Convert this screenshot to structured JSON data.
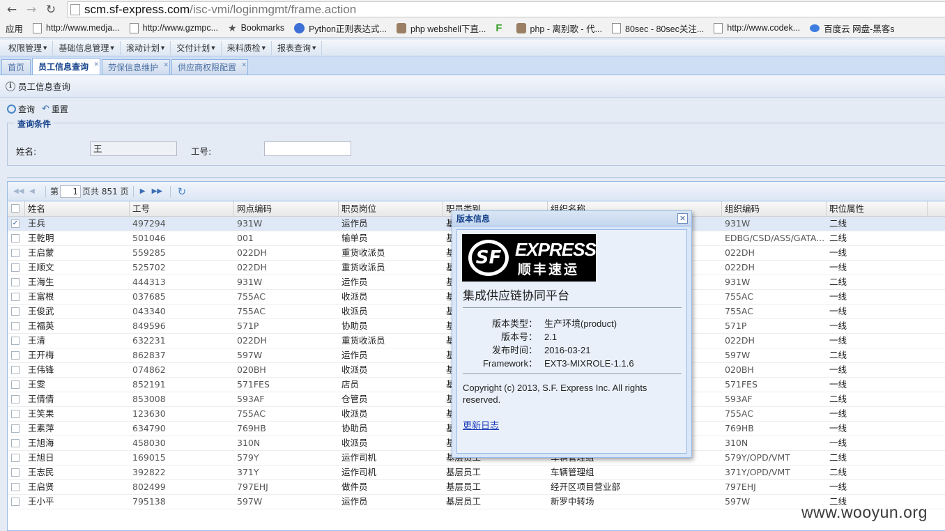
{
  "browser": {
    "url_host": "scm.sf-express.com",
    "url_path": "/isc-vmi/loginmgmt/frame.action",
    "bookmarks": [
      {
        "label": "应用",
        "icon": "apps-grid-icon"
      },
      {
        "label": "http://www.medja...",
        "icon": "page-icon"
      },
      {
        "label": "http://www.gzmpc...",
        "icon": "page-icon"
      },
      {
        "label": "Bookmarks",
        "icon": "star-icon"
      },
      {
        "label": "Python正则表达式...",
        "icon": "python-icon"
      },
      {
        "label": "php webshell下直...",
        "icon": "dog-icon"
      },
      {
        "label": "",
        "icon": "feedly-icon"
      },
      {
        "label": "php - 离别歌 - 代...",
        "icon": "dog-icon"
      },
      {
        "label": "80sec - 80sec关注...",
        "icon": "page-icon"
      },
      {
        "label": "http://www.codek...",
        "icon": "page-icon"
      },
      {
        "label": "百度云 网盘-黑客s",
        "icon": "cloud-icon"
      }
    ]
  },
  "menu": [
    "权限管理",
    "基础信息管理",
    "滚动计划",
    "交付计划",
    "来料质检",
    "报表查询"
  ],
  "tabs": [
    {
      "label": "首页",
      "active": false,
      "closable": false
    },
    {
      "label": "员工信息查询",
      "active": true,
      "closable": true
    },
    {
      "label": "劳保信息维护",
      "active": false,
      "closable": true
    },
    {
      "label": "供应商权限配置",
      "active": false,
      "closable": true
    }
  ],
  "panel": {
    "title": "员工信息查询",
    "query_label": "查询",
    "reset_label": "重置",
    "criteria_legend": "查询条件",
    "name_label": "姓名:",
    "name_value": "王",
    "id_label": "工号:",
    "id_value": ""
  },
  "pager": {
    "prefix": "第",
    "page": "1",
    "suffix": "页共 851 页"
  },
  "grid": {
    "columns": [
      "姓名",
      "工号",
      "网点编码",
      "职员岗位",
      "职员类别",
      "组织名称",
      "组织编码",
      "职位属性"
    ],
    "rows": [
      [
        "王兵",
        "497294",
        "931W",
        "运作员",
        "基",
        "",
        "931W",
        "二线"
      ],
      [
        "王乾明",
        "501046",
        "001",
        "输单员",
        "基",
        "",
        "EDBG/CSD/ASS/GATA...",
        "二线"
      ],
      [
        "王启蒙",
        "559285",
        "022DH",
        "重货收派员",
        "基",
        "",
        "022DH",
        "一线"
      ],
      [
        "王顺文",
        "525702",
        "022DH",
        "重货收派员",
        "基",
        "",
        "022DH",
        "一线"
      ],
      [
        "王海生",
        "444313",
        "931W",
        "运作员",
        "基",
        "",
        "931W",
        "二线"
      ],
      [
        "王富根",
        "037685",
        "755AC",
        "收派员",
        "基",
        "",
        "755AC",
        "一线"
      ],
      [
        "王俊武",
        "043340",
        "755AC",
        "收派员",
        "基",
        "",
        "755AC",
        "一线"
      ],
      [
        "王福英",
        "849596",
        "571P",
        "协助员",
        "基",
        "",
        "571P",
        "一线"
      ],
      [
        "王清",
        "632231",
        "022DH",
        "重货收派员",
        "基",
        "",
        "022DH",
        "一线"
      ],
      [
        "王开梅",
        "862837",
        "597W",
        "运作员",
        "基",
        "",
        "597W",
        "二线"
      ],
      [
        "王伟锋",
        "074862",
        "020BH",
        "收派员",
        "基",
        "",
        "020BH",
        "一线"
      ],
      [
        "王雯",
        "852191",
        "571FES",
        "店员",
        "基",
        "",
        "571FES",
        "一线"
      ],
      [
        "王倩倩",
        "853008",
        "593AF",
        "仓管员",
        "基",
        "",
        "593AF",
        "二线"
      ],
      [
        "王笑果",
        "123630",
        "755AC",
        "收派员",
        "基",
        "",
        "755AC",
        "一线"
      ],
      [
        "王素萍",
        "634790",
        "769HB",
        "协助员",
        "基",
        "",
        "769HB",
        "一线"
      ],
      [
        "王旭海",
        "458030",
        "310N",
        "收派员",
        "基",
        "",
        "310N",
        "一线"
      ],
      [
        "王旭日",
        "169015",
        "579Y",
        "运作司机",
        "基层员工",
        "车辆管理组",
        "579Y/OPD/VMT",
        "二线"
      ],
      [
        "王志民",
        "392822",
        "371Y",
        "运作司机",
        "基层员工",
        "车辆管理组",
        "371Y/OPD/VMT",
        "二线"
      ],
      [
        "王启贤",
        "802499",
        "797EHJ",
        "做件员",
        "基层员工",
        "经开区项目营业部",
        "797EHJ",
        "一线"
      ],
      [
        "王小平",
        "795138",
        "597W",
        "运作员",
        "基层员工",
        "新罗中转场",
        "597W",
        "二线"
      ]
    ]
  },
  "modal": {
    "title": "版本信息",
    "logo_en": "EXPRESS",
    "logo_cn": "顺丰速运",
    "logo_badge": "SF",
    "platform": "集成供应链协同平台",
    "info": [
      {
        "k": "版本类型：",
        "v": "生产环境(product)"
      },
      {
        "k": "版本号：",
        "v": "2.1"
      },
      {
        "k": "发布时间：",
        "v": "2016-03-21"
      },
      {
        "k": "Framework：",
        "v": "EXT3-MIXROLE-1.1.6"
      }
    ],
    "copyright": "Copyright (c) 2013, S.F. Express Inc. All rights reserved.",
    "changelog": "更新日志"
  },
  "watermark": "www.wooyun.org"
}
